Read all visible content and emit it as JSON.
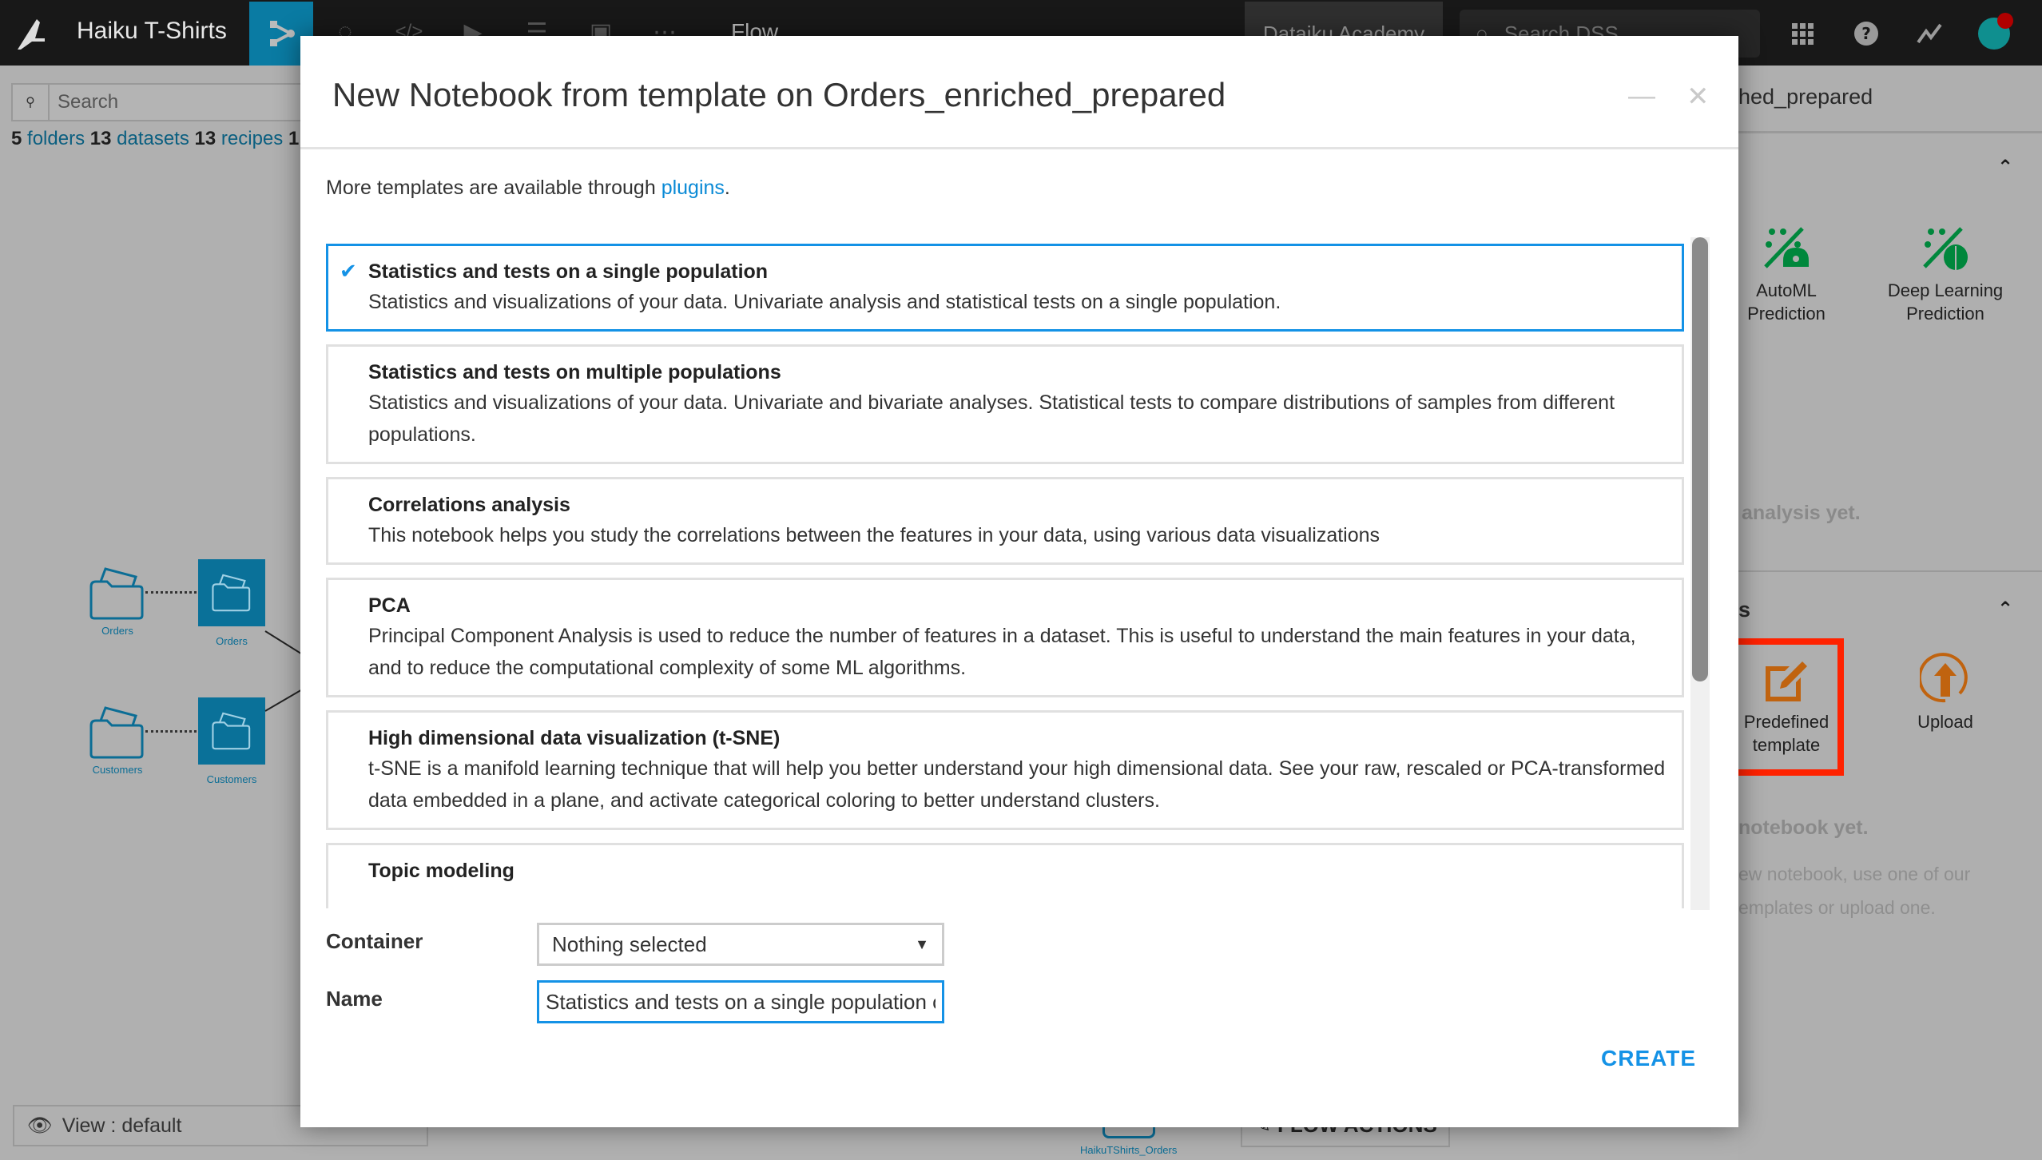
{
  "topbar": {
    "project_name": "Haiku T-Shirts",
    "current_section": "Flow",
    "academy_label": "Dataiku Academy",
    "search_placeholder": "Search DSS",
    "nav_icons": [
      "flow-icon",
      "lab-icon",
      "code-icon",
      "jobs-icon",
      "deploy-icon",
      "dashboard-icon",
      "more-icon"
    ]
  },
  "flow": {
    "search_placeholder": "Search",
    "counts": {
      "folders_count": "5",
      "folders_label": "folders",
      "datasets_count": "13",
      "datasets_label": "datasets",
      "recipes_count": "13",
      "recipes_label": "recipes",
      "trailing": "1"
    },
    "nodes": [
      {
        "label": "Orders",
        "type": "folder"
      },
      {
        "label": "Orders",
        "type": "dataset"
      },
      {
        "label": "Customers",
        "type": "folder"
      },
      {
        "label": "Customers",
        "type": "dataset"
      }
    ],
    "bottom_dataset_label": "HaikuTShirts_Orders",
    "view_label": "View : default",
    "flow_actions_label": "FLOW ACTIONS"
  },
  "right_panel": {
    "title_fragment": "hed_prepared",
    "lab_tiles": [
      {
        "label_line1": "AutoML",
        "label_line2": "Prediction",
        "icon": "automl-prediction-icon",
        "color": "#00873c"
      },
      {
        "label_line1": "Deep Learning",
        "label_line2": "Prediction",
        "icon": "deep-learning-prediction-icon",
        "color": "#00873c"
      }
    ],
    "lab_empty_text": "analysis yet.",
    "notebooks_section_fragment": "s",
    "notebook_tiles": [
      {
        "label_line1": "Predefined",
        "label_line2": "template",
        "icon": "predefined-template-icon",
        "color": "#c0630f"
      },
      {
        "label_line1": "Upload",
        "label_line2": "",
        "icon": "upload-icon",
        "color": "#c0630f"
      }
    ],
    "notebook_empty_title": "notebook yet.",
    "notebook_empty_line1": "ew notebook, use one of our",
    "notebook_empty_line2": "emplates or upload one.",
    "highlight_color": "#ff2200"
  },
  "modal": {
    "title": "New Notebook from template on Orders_enriched_prepared",
    "intro_text": "More templates are available through ",
    "intro_link": "plugins",
    "intro_end": ".",
    "templates": [
      {
        "title": "Statistics and tests on a single population",
        "description": "Statistics and visualizations of your data. Univariate analysis and statistical tests on a single population.",
        "selected": true
      },
      {
        "title": "Statistics and tests on multiple populations",
        "description": "Statistics and visualizations of your data. Univariate and bivariate analyses. Statistical tests to compare distributions of samples from different populations.",
        "selected": false
      },
      {
        "title": "Correlations analysis",
        "description": "This notebook helps you study the correlations between the features in your data, using various data visualizations",
        "selected": false
      },
      {
        "title": "PCA",
        "description": "Principal Component Analysis is used to reduce the number of features in a dataset. This is useful to understand the main features in your data, and to reduce the computational complexity of some ML algorithms.",
        "selected": false
      },
      {
        "title": "High dimensional data visualization (t-SNE)",
        "description": "t-SNE is a manifold learning technique that will help you better understand your high dimensional data. See your raw, rescaled or PCA-transformed data embedded in a plane, and activate categorical coloring to better understand clusters.",
        "selected": false
      },
      {
        "title": "Topic modeling",
        "description": "",
        "selected": false
      }
    ],
    "container_label": "Container",
    "container_value": "Nothing selected",
    "name_label": "Name",
    "name_value": "Statistics and tests on a single population on",
    "create_label": "CREATE",
    "accent_color": "#1492e6"
  }
}
